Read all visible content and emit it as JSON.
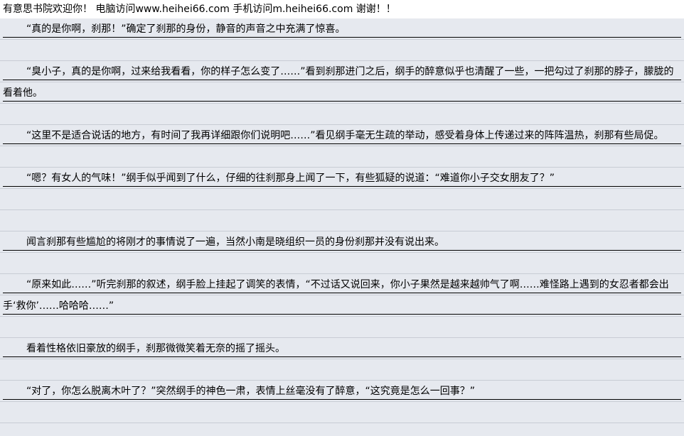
{
  "header": {
    "text": "有意思书院欢迎你！ 电脑访问www.heihei66.com 手机访问m.heihei66.com 谢谢！！"
  },
  "paragraphs": [
    "“真的是你啊，刹那！”确定了刹那的身份，静音的声音之中充满了惊喜。",
    "“臭小子，真的是你啊，过来给我看看，你的样子怎么变了……”看到刹那进门之后，纲手的醉意似乎也清醒了一些，一把勾过了刹那的脖子，朦胧的看着他。",
    "“这里不是适合说话的地方，有时间了我再详细跟你们说明吧……”看见纲手毫无生疏的举动，感受着身体上传递过来的阵阵温热，刹那有些局促。",
    "“嗯？有女人的气味！”纲手似乎闻到了什么，仔细的往刹那身上闻了一下，有些狐疑的说道：“难道你小子交女朋友了？”",
    "闻言刹那有些尴尬的将刚才的事情说了一遍，当然小南是晓组织一员的身份刹那并没有说出来。",
    "“原来如此……”听完刹那的叙述，纲手脸上挂起了调笑的表情，“不过话又说回来，你小子果然是越来越帅气了啊……难怪路上遇到的女忍者都会出手‘救你’……哈哈哈……”",
    "看着性格依旧豪放的纲手，刹那微微笑着无奈的摇了摇头。",
    "“对了，你怎么脱离木叶了？”突然纲手的神色一肃，表情上丝毫没有了醉意，“这究竟是怎么一回事？”"
  ]
}
